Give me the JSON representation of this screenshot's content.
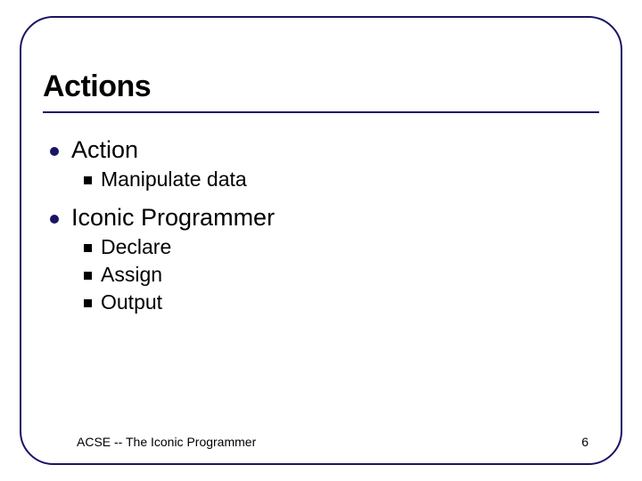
{
  "title": "Actions",
  "bullets": [
    {
      "label": "Action",
      "children": [
        "Manipulate data"
      ]
    },
    {
      "label": "Iconic Programmer",
      "children": [
        "Declare",
        "Assign",
        "Output"
      ]
    }
  ],
  "footer": {
    "left": "ACSE -- The Iconic Programmer",
    "page": "6"
  },
  "colors": {
    "frame": "#1a1464",
    "text": "#000000"
  }
}
